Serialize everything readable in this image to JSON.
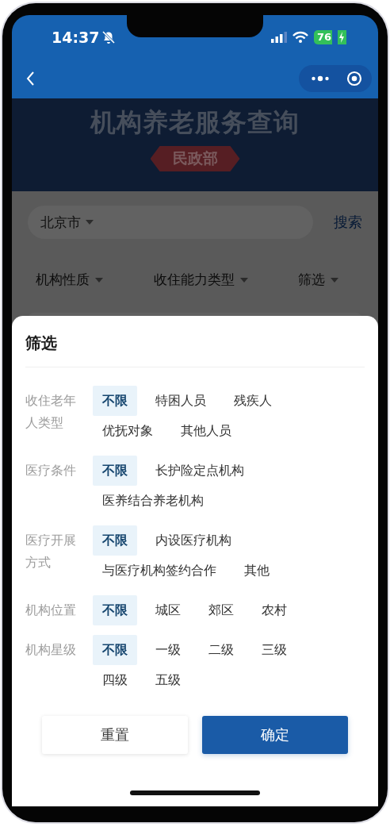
{
  "status_bar": {
    "time": "14:37",
    "battery": "76"
  },
  "banner": {
    "title": "机构养老服务查询",
    "badge": "民政部"
  },
  "search": {
    "city": "北京市",
    "button": "搜索"
  },
  "filters": [
    "机构性质",
    "收住能力类型",
    "筛选"
  ],
  "sheet": {
    "title": "筛选",
    "groups": [
      {
        "label": "收住老年人类型",
        "options": [
          {
            "label": "不限",
            "selected": true
          },
          {
            "label": "特困人员",
            "selected": false
          },
          {
            "label": "残疾人",
            "selected": false
          },
          {
            "label": "优抚对象",
            "selected": false
          },
          {
            "label": "其他人员",
            "selected": false
          }
        ]
      },
      {
        "label": "医疗条件",
        "options": [
          {
            "label": "不限",
            "selected": true
          },
          {
            "label": "长护险定点机构",
            "selected": false
          },
          {
            "label": "医养结合养老机构",
            "selected": false
          }
        ]
      },
      {
        "label": "医疗开展方式",
        "options": [
          {
            "label": "不限",
            "selected": true
          },
          {
            "label": "内设医疗机构",
            "selected": false
          },
          {
            "label": "与医疗机构签约合作",
            "selected": false
          },
          {
            "label": "其他",
            "selected": false
          }
        ]
      },
      {
        "label": "机构位置",
        "options": [
          {
            "label": "不限",
            "selected": true
          },
          {
            "label": "城区",
            "selected": false
          },
          {
            "label": "郊区",
            "selected": false
          },
          {
            "label": "农村",
            "selected": false
          }
        ]
      },
      {
        "label": "机构星级",
        "options": [
          {
            "label": "不限",
            "selected": true
          },
          {
            "label": "一级",
            "selected": false
          },
          {
            "label": "二级",
            "selected": false
          },
          {
            "label": "三级",
            "selected": false
          },
          {
            "label": "四级",
            "selected": false
          },
          {
            "label": "五级",
            "selected": false
          }
        ]
      }
    ],
    "buttons": [
      {
        "label": "重置",
        "kind": "secondary"
      },
      {
        "label": "确定",
        "kind": "primary"
      }
    ]
  }
}
